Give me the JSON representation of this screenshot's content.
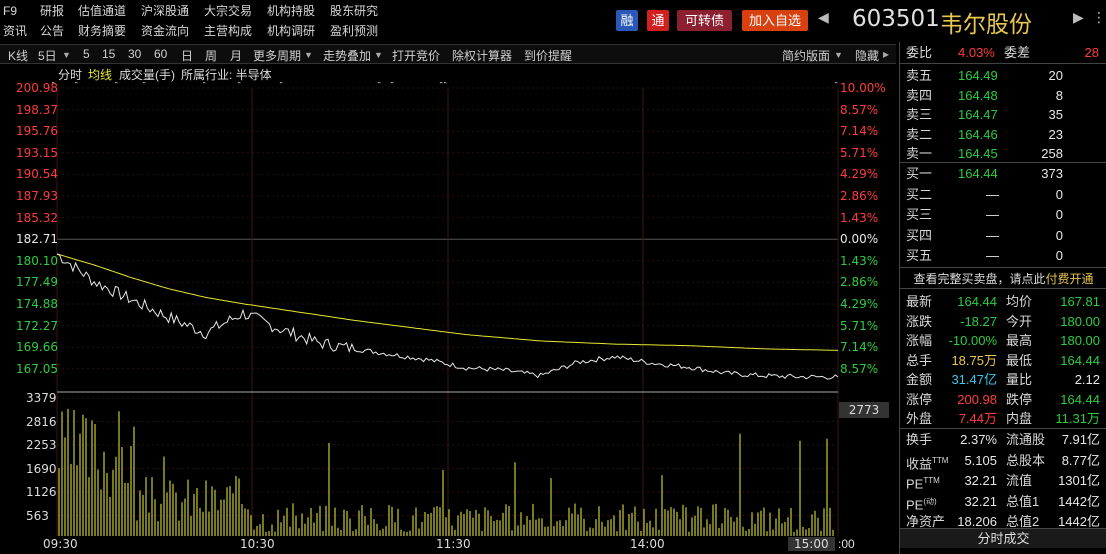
{
  "menu": {
    "row1": [
      "F9",
      "研报",
      "估值通道",
      "沪深股通",
      "大宗交易",
      "机构持股",
      "股东研究"
    ],
    "row2": [
      "资讯",
      "公告",
      "财务摘要",
      "资金流向",
      "主营构成",
      "机构调研",
      "盈利预测"
    ]
  },
  "badges": {
    "rong": "融",
    "tong": "通",
    "kzz": "可转债",
    "add": "加入自选"
  },
  "stock": {
    "code": "603501",
    "name": "韦尔股份"
  },
  "toolbar": {
    "items": [
      "K线",
      "5日",
      "5",
      "15",
      "30",
      "60",
      "日",
      "周",
      "月",
      "更多周期",
      "走势叠加",
      "打开竞价",
      "除权计算器",
      "到价提醒"
    ],
    "right": [
      "简约版面",
      "隐藏"
    ]
  },
  "legend": {
    "fenshi": "分时",
    "junxian": "均线",
    "volume": "成交量(手)",
    "industry": "所属行业: 半导体"
  },
  "chart": {
    "price_labels": [
      "200.98",
      "198.37",
      "195.76",
      "193.15",
      "190.54",
      "187.93",
      "185.32",
      "182.71",
      "180.10",
      "177.49",
      "174.88",
      "172.27",
      "169.66",
      "167.05"
    ],
    "pct_labels": [
      "10.00%",
      "8.57%",
      "7.14%",
      "5.71%",
      "4.29%",
      "2.86%",
      "1.43%",
      "0.00%",
      "1.43%",
      "2.86%",
      "4.29%",
      "5.71%",
      "7.14%",
      "8.57%"
    ],
    "vol_labels": [
      "3379",
      "2816",
      "2253",
      "1690",
      "1126",
      "563"
    ],
    "time_labels": [
      "09:30",
      "10:30",
      "11:30",
      "14:00",
      "15:00"
    ],
    "current_vol": "2773",
    "colors": {
      "up": "#ff3c3c",
      "down": "#2ecc40",
      "neutral": "#e8e8e8",
      "avg": "#e8e830",
      "vol": "#c8c830"
    }
  },
  "chart_data": {
    "type": "line",
    "title": "",
    "xlabel": "",
    "ylabel": "",
    "ylim": [
      164.44,
      200.98
    ],
    "x": [
      "09:30",
      "09:35",
      "09:40",
      "09:45",
      "09:50",
      "09:55",
      "10:00",
      "10:10",
      "10:20",
      "10:30",
      "10:45",
      "11:00",
      "11:15",
      "11:30",
      "13:10",
      "13:20",
      "13:30",
      "13:45",
      "14:00",
      "14:15",
      "14:30",
      "15:00"
    ],
    "series": [
      {
        "values": [
          180.0,
          176.5,
          174.2,
          172.0,
          170.0,
          172.5,
          170.5,
          168.8,
          168.0,
          167.3,
          166.6,
          165.6,
          165.3,
          164.6,
          166.3,
          167.0,
          166.2,
          165.7,
          164.9,
          164.6,
          164.45,
          164.44
        ]
      },
      {
        "values": [
          180.0,
          178.6,
          177.0,
          175.6,
          174.5,
          173.7,
          173.0,
          172.3,
          171.6,
          171.0,
          170.4,
          169.8,
          169.4,
          169.0,
          168.8,
          168.6,
          168.5,
          168.4,
          168.2,
          168.0,
          167.9,
          167.81
        ]
      }
    ],
    "volume_ylim": [
      0,
      3379
    ]
  },
  "quote": {
    "weibi_label": "委比",
    "weibi": "4.03%",
    "weicha_label": "委差",
    "weicha": "28",
    "asks": [
      {
        "label": "卖五",
        "price": "164.49",
        "vol": "20"
      },
      {
        "label": "卖四",
        "price": "164.48",
        "vol": "8"
      },
      {
        "label": "卖三",
        "price": "164.47",
        "vol": "35"
      },
      {
        "label": "卖二",
        "price": "164.46",
        "vol": "23"
      },
      {
        "label": "卖一",
        "price": "164.45",
        "vol": "258"
      }
    ],
    "bids": [
      {
        "label": "买一",
        "price": "164.44",
        "vol": "373"
      },
      {
        "label": "买二",
        "price": "—",
        "vol": "0"
      },
      {
        "label": "买三",
        "price": "—",
        "vol": "0"
      },
      {
        "label": "买四",
        "price": "—",
        "vol": "0"
      },
      {
        "label": "买五",
        "price": "—",
        "vol": "0"
      }
    ],
    "full_depth": "查看完整买卖盘，请点此",
    "full_depth_link": "付费开通",
    "stats": [
      {
        "l1": "最新",
        "v1": "164.44",
        "c1": "green",
        "l2": "均价",
        "v2": "167.81",
        "c2": "green"
      },
      {
        "l1": "涨跌",
        "v1": "-18.27",
        "c1": "green",
        "l2": "今开",
        "v2": "180.00",
        "c2": "green"
      },
      {
        "l1": "涨幅",
        "v1": "-10.00%",
        "c1": "green",
        "l2": "最高",
        "v2": "180.00",
        "c2": "green"
      },
      {
        "l1": "总手",
        "v1": "18.75万",
        "c1": "yellow",
        "l2": "最低",
        "v2": "164.44",
        "c2": "green"
      },
      {
        "l1": "金额",
        "v1": "31.47亿",
        "c1": "cyan",
        "l2": "量比",
        "v2": "2.12",
        "c2": "white"
      },
      {
        "l1": "涨停",
        "v1": "200.98",
        "c1": "red",
        "l2": "跌停",
        "v2": "164.44",
        "c2": "green"
      },
      {
        "l1": "外盘",
        "v1": "7.44万",
        "c1": "red",
        "l2": "内盘",
        "v2": "11.31万",
        "c2": "green"
      },
      {
        "l1": "换手",
        "v1": "2.37%",
        "c1": "white",
        "l2": "流通股",
        "v2": "7.91亿",
        "c2": "white"
      },
      {
        "l1": "收益TTM",
        "v1": "5.105",
        "c1": "white",
        "l2": "总股本",
        "v2": "8.77亿",
        "c2": "white"
      },
      {
        "l1": "PETTM",
        "v1": "32.21",
        "c1": "white",
        "l2": "流值",
        "v2": "1301亿",
        "c2": "white"
      },
      {
        "l1": "PE(动)",
        "v1": "32.21",
        "c1": "white",
        "l2": "总值1",
        "v2": "1442亿",
        "c2": "white"
      },
      {
        "l1": "净资产",
        "v1": "18.206",
        "c1": "white",
        "l2": "总值2",
        "v2": "1442亿",
        "c2": "white"
      }
    ],
    "fenshi_button": "分时成交"
  }
}
